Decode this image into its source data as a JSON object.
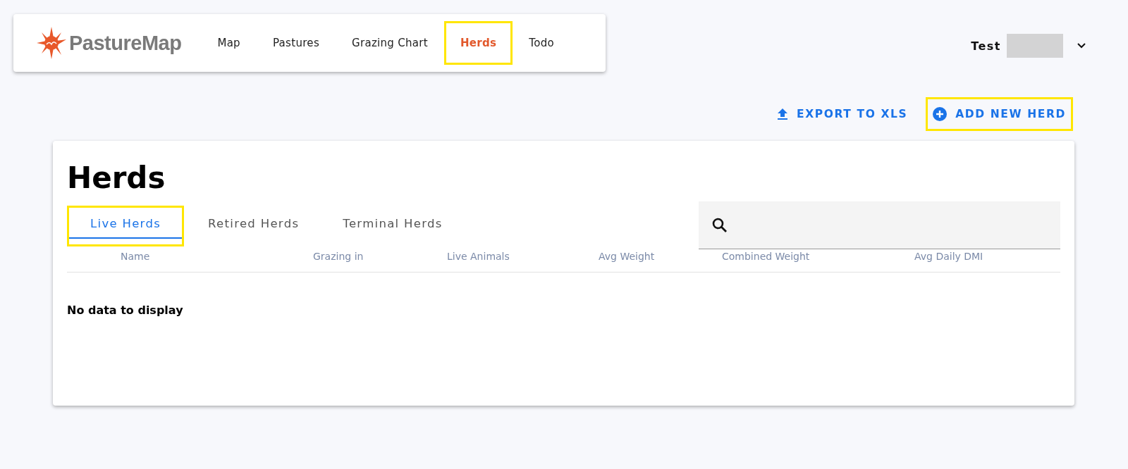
{
  "brand": {
    "name": "PastureMap"
  },
  "nav": [
    {
      "label": "Map",
      "selected": false,
      "highlighted": false
    },
    {
      "label": "Pastures",
      "selected": false,
      "highlighted": false
    },
    {
      "label": "Grazing Chart",
      "selected": false,
      "highlighted": false
    },
    {
      "label": "Herds",
      "selected": true,
      "highlighted": true
    },
    {
      "label": "Todo",
      "selected": false,
      "highlighted": false
    }
  ],
  "user": {
    "name": "Test"
  },
  "actions": [
    {
      "kind": "export",
      "label": "EXPORT TO XLS",
      "highlighted": false
    },
    {
      "kind": "add",
      "label": "ADD NEW HERD",
      "highlighted": true
    }
  ],
  "page": {
    "title": "Herds"
  },
  "tabs": [
    {
      "label": "Live Herds",
      "selected": true,
      "highlighted": true
    },
    {
      "label": "Retired Herds",
      "selected": false,
      "highlighted": false
    },
    {
      "label": "Terminal Herds",
      "selected": false,
      "highlighted": false
    }
  ],
  "table": {
    "columns": [
      "Name",
      "Grazing in",
      "Live Animals",
      "Avg Weight",
      "Combined Weight",
      "Avg Daily DMI"
    ],
    "empty_message": "No data to display"
  }
}
